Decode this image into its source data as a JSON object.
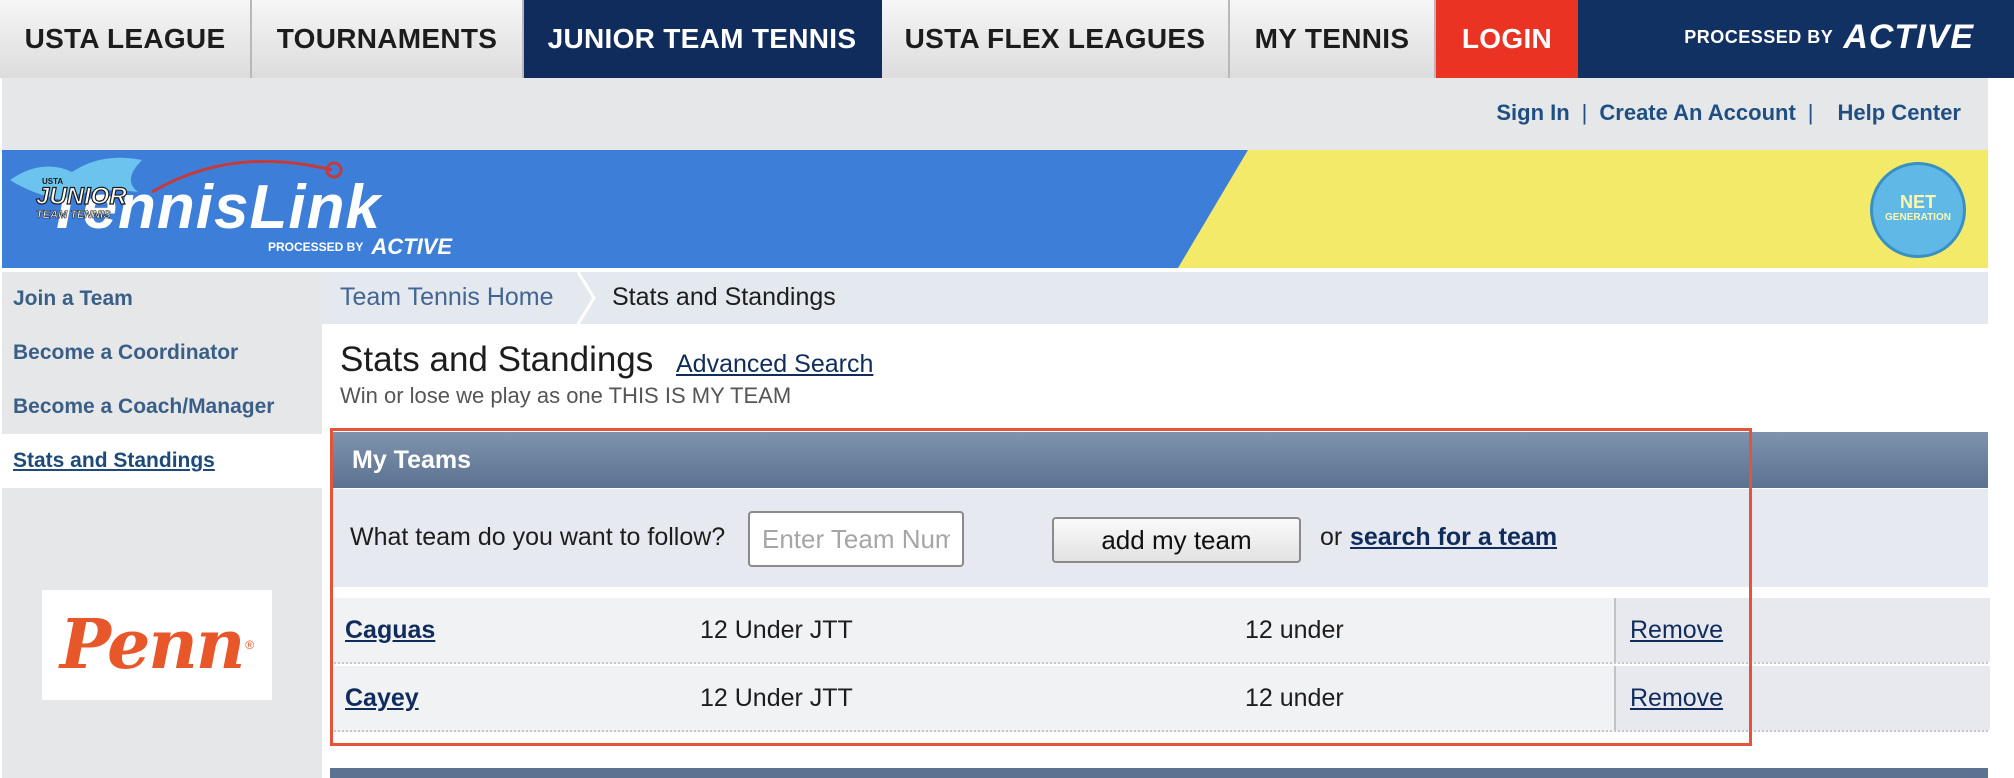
{
  "topnav": {
    "tabs": [
      {
        "label": "USTA LEAGUE"
      },
      {
        "label": "TOURNAMENTS"
      },
      {
        "label": "JUNIOR TEAM TENNIS"
      },
      {
        "label": "USTA FLEX LEAGUES"
      },
      {
        "label": "MY TENNIS"
      },
      {
        "label": "LOGIN"
      }
    ],
    "processed_by": "PROCESSED BY",
    "active_logo": "ACTIVE"
  },
  "utility": {
    "sign_in": "Sign In",
    "separator": "|",
    "create_account": "Create An Account",
    "help_center": "Help Center"
  },
  "banner": {
    "logo": "TennisLink",
    "processed_by": "PROCESSED BY",
    "active_logo": "ACTIVE",
    "jtt_small": "USTA",
    "jtt_top": "JUNIOR",
    "jtt_bottom": "TEAM TENNIS",
    "netgen_line1": "NET",
    "netgen_line2": "GENERATION",
    "colors": {
      "blue": "#3d7fd8",
      "yellow": "#f4ea6a"
    }
  },
  "sidebar": {
    "items": [
      {
        "label": "Join a Team"
      },
      {
        "label": "Become a Coordinator"
      },
      {
        "label": "Become a Coach/Manager"
      },
      {
        "label": "Stats and Standings"
      }
    ],
    "sponsor": "Penn",
    "sponsor_mark": "®"
  },
  "breadcrumb": {
    "home": "Team Tennis Home",
    "current": "Stats and Standings"
  },
  "main": {
    "title": "Stats and Standings",
    "advanced_search": "Advanced Search",
    "subtitle": "Win or lose we play as one THIS IS MY TEAM"
  },
  "my_teams": {
    "heading": "My Teams",
    "follow_label": "What team do you want to follow?",
    "input_placeholder": "Enter Team Number",
    "input_value": "",
    "add_button": "add my team",
    "or_text": "or",
    "search_link": "search for a team",
    "rows": [
      {
        "name": "Caguas",
        "division": "12 Under JTT",
        "age": "12 under",
        "action": "Remove"
      },
      {
        "name": "Cayey",
        "division": "12 Under JTT",
        "age": "12 under",
        "action": "Remove"
      }
    ]
  }
}
